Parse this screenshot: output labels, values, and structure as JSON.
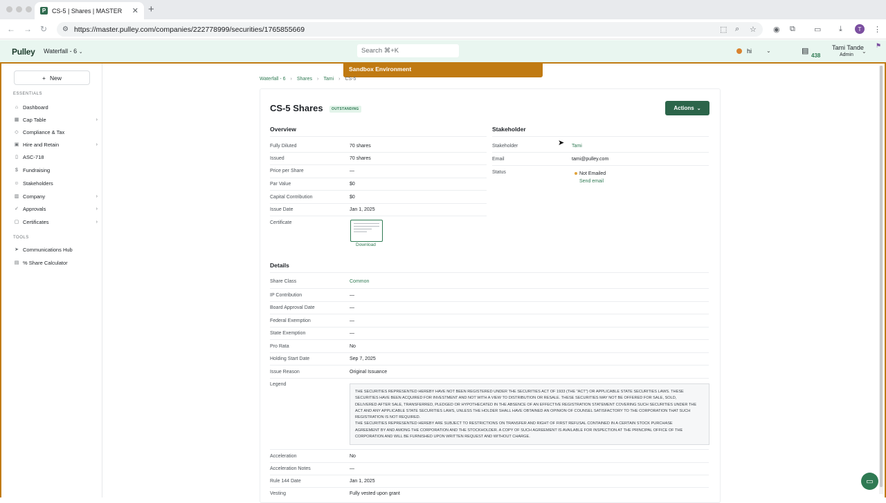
{
  "browser": {
    "tab_title": "CS-5 | Shares | MASTER",
    "tab_favicon": "P",
    "url": "https://master.pulley.com/companies/222778999/securities/1765855669",
    "profile_initial": "T"
  },
  "header": {
    "logo": "Pulley",
    "company": "Waterfall - 6",
    "search_placeholder": "Search ⌘+K",
    "status_text": "hi",
    "task_count": "438",
    "user_name": "Tami Tande",
    "user_role": "Admin"
  },
  "banner": "Sandbox Environment",
  "sidebar": {
    "new_label": "New",
    "essentials_label": "ESSENTIALS",
    "tools_label": "TOOLS",
    "items": [
      {
        "label": "Dashboard",
        "icon": "home-icon"
      },
      {
        "label": "Cap Table",
        "icon": "table-icon"
      },
      {
        "label": "Compliance & Tax",
        "icon": "shield-icon"
      },
      {
        "label": "Hire and Retain",
        "icon": "briefcase-icon"
      },
      {
        "label": "ASC-718",
        "icon": "document-icon"
      },
      {
        "label": "Fundraising",
        "icon": "dollar-icon"
      },
      {
        "label": "Stakeholders",
        "icon": "users-icon"
      },
      {
        "label": "Company",
        "icon": "building-icon"
      },
      {
        "label": "Approvals",
        "icon": "thumbs-up-icon"
      },
      {
        "label": "Certificates",
        "icon": "certificate-icon"
      }
    ],
    "tools": [
      {
        "label": "Communications Hub",
        "icon": "send-icon"
      },
      {
        "label": "% Share Calculator",
        "icon": "calculator-icon"
      }
    ]
  },
  "breadcrumbs": [
    "Waterfall - 6",
    "Shares",
    "Tami",
    "CS-5"
  ],
  "page": {
    "title": "CS-5 Shares",
    "badge": "OUTSTANDING",
    "actions_label": "Actions"
  },
  "overview": {
    "heading": "Overview",
    "rows": [
      {
        "label": "Fully Diluted",
        "value": "70 shares"
      },
      {
        "label": "Issued",
        "value": "70 shares"
      },
      {
        "label": "Price per Share",
        "value": "—"
      },
      {
        "label": "Par Value",
        "value": "$0"
      },
      {
        "label": "Capital Contribution",
        "value": "$0"
      },
      {
        "label": "Issue Date",
        "value": "Jan 1, 2025"
      },
      {
        "label": "Certificate",
        "value": ""
      }
    ],
    "download_label": "Download"
  },
  "stakeholder": {
    "heading": "Stakeholder",
    "stakeholder_label": "Stakeholder",
    "stakeholder_value": "Tami",
    "email_label": "Email",
    "email_value": "tami@pulley.com",
    "status_label": "Status",
    "status_value": "Not Emailed",
    "send_email_label": "Send email"
  },
  "details": {
    "heading": "Details",
    "rows": [
      {
        "label": "Share Class",
        "value": "Common"
      },
      {
        "label": "IP Contribution",
        "value": "—"
      },
      {
        "label": "Board Approval Date",
        "value": "—"
      },
      {
        "label": "Federal Exemption",
        "value": "—"
      },
      {
        "label": "State Exemption",
        "value": "—"
      },
      {
        "label": "Pro Rata",
        "value": "No"
      },
      {
        "label": "Holding Start Date",
        "value": "Sep 7, 2025"
      },
      {
        "label": "Issue Reason",
        "value": "Original Issuance"
      },
      {
        "label": "Legend",
        "value": ""
      }
    ],
    "legend_text": "THE SECURITIES REPRESENTED HEREBY HAVE NOT BEEN REGISTERED UNDER THE SECURITIES ACT OF 1933 (THE \"ACT\") OR APPLICABLE STATE SECURITIES LAWS.  THESE\nSECURITIES HAVE BEEN ACQUIRED FOR INVESTMENT AND NOT WITH A VIEW TO DISTRIBUTION OR RESALE.  THESE SECURITIES MAY NOT BE OFFERED FOR SALE, SOLD,\nDELIVERED AFTER SALE, TRANSFERRED, PLEDGED OR HYPOTHECATED IN THE ABSENCE OF AN EFFECTIVE REGISTRATION STATEMENT COVERING SUCH SECURITIES UNDER THE\nACT AND ANY APPLICABLE STATE SECURITIES LAWS, UNLESS THE HOLDER SHALL HAVE OBTAINED AN OPINION OF COUNSEL SATISFACTORY TO THE CORPORATION THAT SUCH\nREGISTRATION IS NOT REQUIRED.\nTHE SECURITIES REPRESENTED HEREBY ARE SUBJECT TO RESTRICTIONS ON TRANSFER AND RIGHT OF FIRST REFUSAL CONTAINED IN A CERTAIN STOCK PURCHASE\nAGREEMENT BY AND AMONG THE CORPORATION AND THE STOCKHOLDER. A COPY OF SUCH AGREEMENT IS AVAILABLE FOR INSPECTION AT THE PRINCIPAL OFFICE OF THE\nCORPORATION AND WILL BE FURNISHED UPON WRITTEN REQUEST AND WITHOUT CHARGE.",
    "rows_after": [
      {
        "label": "Acceleration",
        "value": "No"
      },
      {
        "label": "Acceleration Notes",
        "value": "—"
      },
      {
        "label": "Rule 144 Date",
        "value": "Jan 1, 2025"
      },
      {
        "label": "Vesting",
        "value": "Fully vested upon grant"
      }
    ]
  },
  "colors": {
    "brand_green": "#2c654a",
    "sandbox_orange": "#c07a12",
    "header_bg": "#e9f6f0"
  }
}
